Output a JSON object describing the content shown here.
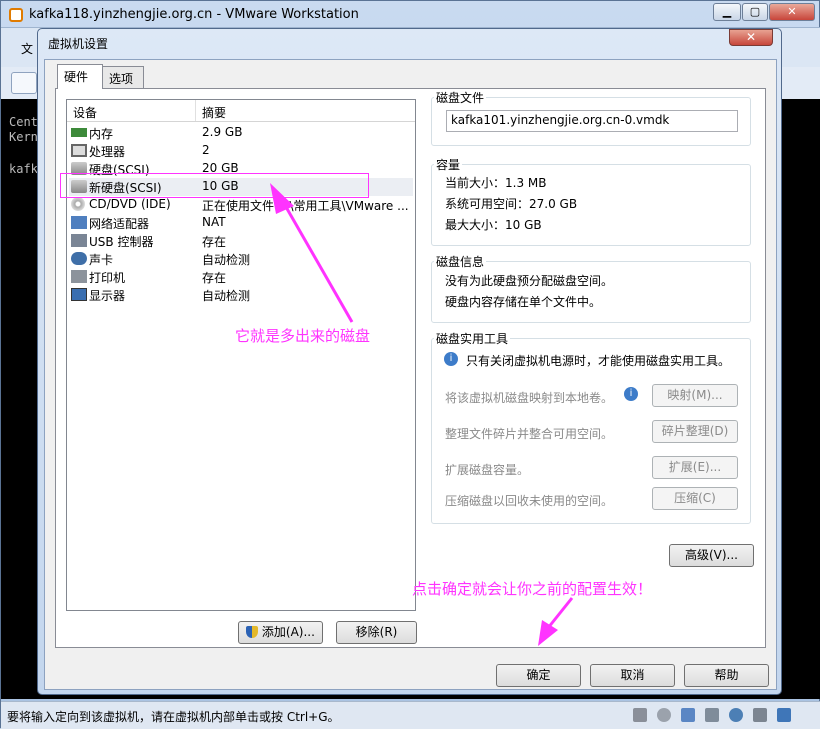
{
  "window": {
    "title": "kafka118.yinzhengjie.org.cn - VMware Workstation",
    "menu_partial": "文",
    "min": "▁",
    "max": "▢",
    "close": "✕"
  },
  "console": {
    "lines": [
      "Cent",
      "Kern",
      "",
      "kafk"
    ]
  },
  "statusbar": {
    "text": "要将输入定向到该虚拟机，请在虚拟机内部单击或按 Ctrl+G。"
  },
  "dialog": {
    "title": "虚拟机设置",
    "close": "✕",
    "tabs": [
      "硬件",
      "选项"
    ],
    "device_table": {
      "headers": [
        "设备",
        "摘要"
      ],
      "rows": [
        {
          "device": "内存",
          "summary": "2.9 GB",
          "icon": "memory-icon"
        },
        {
          "device": "处理器",
          "summary": "2",
          "icon": "cpu-icon"
        },
        {
          "device": "硬盘(SCSI)",
          "summary": "20 GB",
          "icon": "harddisk-icon"
        },
        {
          "device": "新硬盘(SCSI)",
          "summary": "10 GB",
          "icon": "harddisk-icon"
        },
        {
          "device": "CD/DVD (IDE)",
          "summary": "正在使用文件 E:\\常用工具\\VMware ...",
          "icon": "cdrom-icon"
        },
        {
          "device": "网络适配器",
          "summary": "NAT",
          "icon": "network-icon"
        },
        {
          "device": "USB 控制器",
          "summary": "存在",
          "icon": "usb-icon"
        },
        {
          "device": "声卡",
          "summary": "自动检测",
          "icon": "sound-icon"
        },
        {
          "device": "打印机",
          "summary": "存在",
          "icon": "printer-icon"
        },
        {
          "device": "显示器",
          "summary": "自动检测",
          "icon": "monitor-icon"
        }
      ]
    },
    "add_button": "添加(A)...",
    "remove_button": "移除(R)",
    "disk_file": {
      "label": "磁盘文件",
      "value": "kafka101.yinzhengjie.org.cn-0.vmdk"
    },
    "capacity": {
      "label": "容量",
      "current": "当前大小：1.3 MB",
      "available": "系统可用空间：27.0 GB",
      "max": "最大大小：10 GB"
    },
    "disk_info": {
      "label": "磁盘信息",
      "line1": "没有为此硬盘预分配磁盘空间。",
      "line2": "硬盘内容存储在单个文件中。"
    },
    "utilities": {
      "label": "磁盘实用工具",
      "note": "只有关闭虚拟机电源时，才能使用磁盘实用工具。",
      "map_text": "将该虚拟机磁盘映射到本地卷。",
      "map_button": "映射(M)...",
      "defrag_text": "整理文件碎片并整合可用空间。",
      "defrag_button": "碎片整理(D)",
      "expand_text": "扩展磁盘容量。",
      "expand_button": "扩展(E)...",
      "compact_text": "压缩磁盘以回收未使用的空间。",
      "compact_button": "压缩(C)"
    },
    "advanced_button": "高级(V)...",
    "ok_button": "确定",
    "cancel_button": "取消",
    "help_button": "帮助"
  },
  "annotations": {
    "disk_note": "它就是多出来的磁盘",
    "ok_note": "点击确定就会让你之前的配置生效！",
    "color": "#ff33ff"
  }
}
